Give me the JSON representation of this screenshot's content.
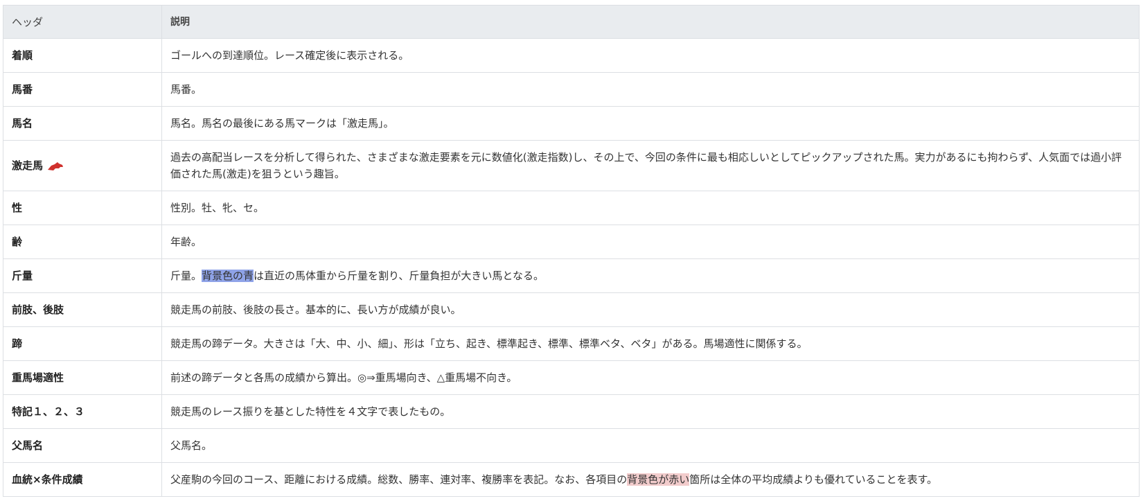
{
  "table": {
    "headers": [
      "ヘッダ",
      "説明"
    ],
    "rows": [
      {
        "name": "着順",
        "desc": "ゴールへの到達順位。レース確定後に表示される。"
      },
      {
        "name": "馬番",
        "desc": "馬番。"
      },
      {
        "name": "馬名",
        "desc": "馬名。馬名の最後にある馬マークは「激走馬」。"
      },
      {
        "name": "激走馬",
        "icon": "red-horse-icon",
        "desc": "過去の高配当レースを分析して得られた、さまざまな激走要素を元に数値化(激走指数)し、その上で、今回の条件に最も相応しいとしてピックアップされた馬。実力があるにも拘わらず、人気面では過小評価された馬(激走)を狙うという趣旨。"
      },
      {
        "name": "性",
        "desc": "性別。牡、牝、セ。"
      },
      {
        "name": "齢",
        "desc": "年齢。"
      },
      {
        "name": "斤量",
        "desc_pre": "斤量。",
        "desc_hl": "背景色の青",
        "desc_post": "は直近の馬体重から斤量を割り、斤量負担が大きい馬となる。"
      },
      {
        "name": "前肢、後肢",
        "desc": "競走馬の前肢、後肢の長さ。基本的に、長い方が成績が良い。"
      },
      {
        "name": "蹄",
        "desc": "競走馬の蹄データ。大きさは「大、中、小、細」、形は「立ち、起き、標準起き、標準、標準ベタ、ベタ」がある。馬場適性に関係する。"
      },
      {
        "name": "重馬場適性",
        "desc": "前述の蹄データと各馬の成績から算出。◎⇒重馬場向き、△重馬場不向き。"
      },
      {
        "name": "特記１、２、３",
        "desc": "競走馬のレース振りを基とした特性を４文字で表したもの。"
      },
      {
        "name": "父馬名",
        "desc": "父馬名。"
      },
      {
        "name": "血統×条件成績",
        "desc_pre": "父産駒の今回のコース、距離における成績。総数、勝率、連対率、複勝率を表記。なお、各項目の",
        "desc_hl": "背景色が赤い",
        "desc_post": "箇所は全体の平均成績よりも優れていることを表す。"
      }
    ]
  },
  "colors": {
    "header_bg": "#e9ecef",
    "border": "#dcdfe3",
    "highlight_blue": "#8fa3e8",
    "highlight_red": "#f2cccc",
    "horse_icon": "#d0312d"
  }
}
